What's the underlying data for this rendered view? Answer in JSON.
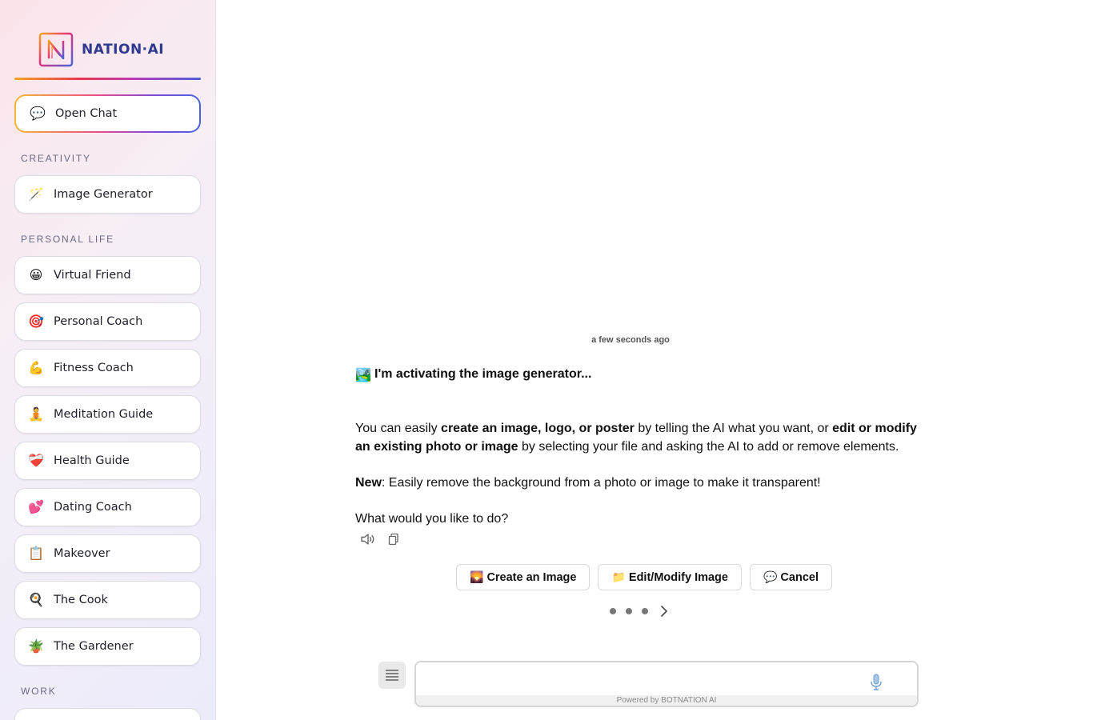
{
  "brand": {
    "name": "NATION·AI"
  },
  "sidebar": {
    "open_chat": {
      "icon": "💬",
      "label": "Open Chat"
    },
    "sections": [
      {
        "title": "CREATIVITY",
        "items": [
          {
            "icon": "🪄",
            "label": "Image Generator"
          }
        ]
      },
      {
        "title": "PERSONAL LIFE",
        "items": [
          {
            "icon": "😀",
            "label": "Virtual Friend"
          },
          {
            "icon": "🎯",
            "label": "Personal Coach"
          },
          {
            "icon": "💪",
            "label": "Fitness Coach"
          },
          {
            "icon": "🧘",
            "label": "Meditation Guide"
          },
          {
            "icon": "❤️‍🩹",
            "label": "Health Guide"
          },
          {
            "icon": "💕",
            "label": "Dating Coach"
          },
          {
            "icon": "📋",
            "label": "Makeover"
          },
          {
            "icon": "🍳",
            "label": "The Cook"
          },
          {
            "icon": "🪴",
            "label": "The Gardener"
          }
        ]
      },
      {
        "title": "WORK",
        "items": []
      }
    ]
  },
  "chat": {
    "timestamp": "a few seconds ago",
    "message": {
      "icon": "🏞️",
      "heading": "I'm activating the image generator...",
      "p1_a": "You can easily ",
      "p1_b": "create an image, logo, or poster",
      "p1_c": " by telling the AI what you want, or ",
      "p1_d": "edit or modify an existing photo or image",
      "p1_e": " by selecting your file and asking the AI to add or remove elements.",
      "p2_a": "New",
      "p2_b": ": Easily remove the background from a photo or image to make it transparent!",
      "p3": "What would you like to do?"
    },
    "actions": [
      {
        "icon": "🌄",
        "label": "Create an Image"
      },
      {
        "icon": "📁",
        "label": "Edit/Modify Image"
      },
      {
        "icon": "💬",
        "label": "Cancel"
      }
    ],
    "input": {
      "placeholder": "",
      "value": ""
    },
    "powered_by": "Powered by BOTNATION AI"
  }
}
